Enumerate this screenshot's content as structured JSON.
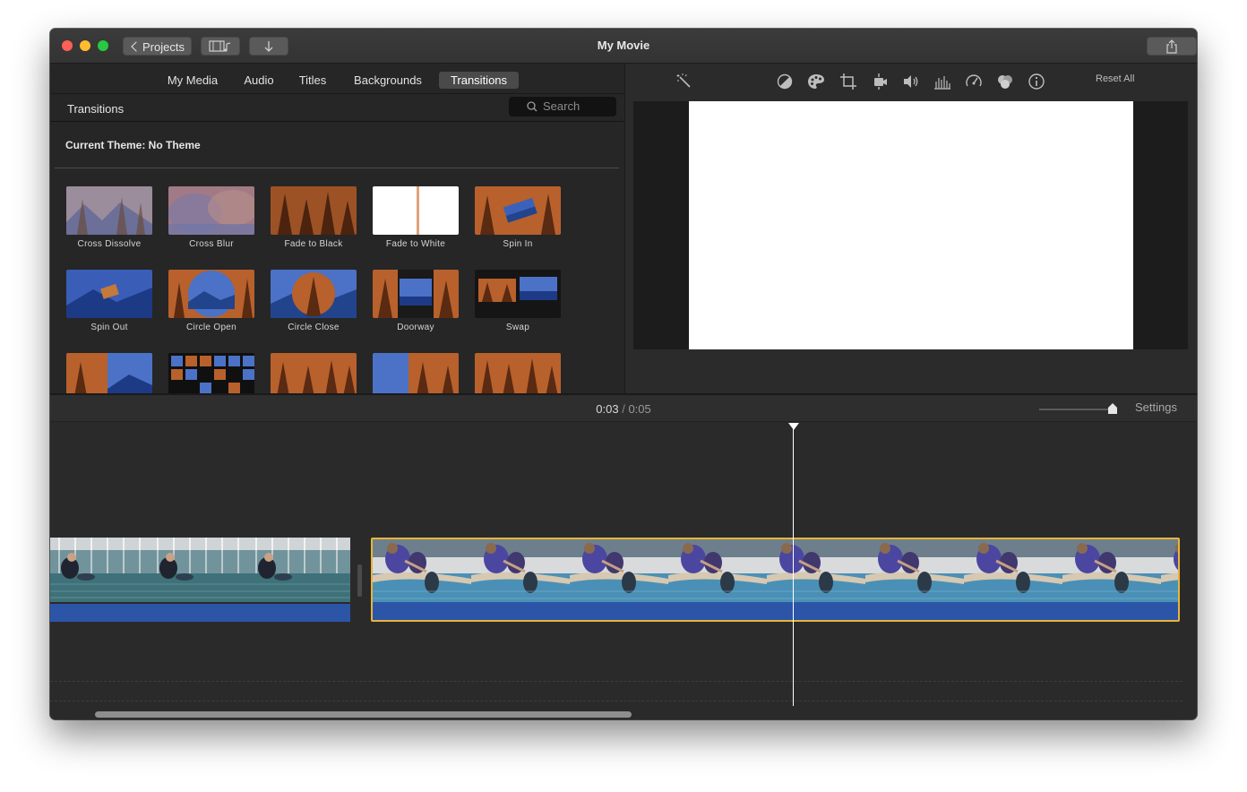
{
  "window": {
    "title": "My Movie"
  },
  "toolbar": {
    "projects_label": "Projects",
    "media_icon": "media-browser-icon",
    "import_icon": "import-arrow-icon",
    "share_icon": "share-icon"
  },
  "browser": {
    "tabs": [
      {
        "label": "My Media",
        "active": false
      },
      {
        "label": "Audio",
        "active": false
      },
      {
        "label": "Titles",
        "active": false
      },
      {
        "label": "Backgrounds",
        "active": false
      },
      {
        "label": "Transitions",
        "active": true
      }
    ],
    "section_title": "Transitions",
    "search_placeholder": "Search",
    "theme_label": "Current Theme: No Theme",
    "transitions": [
      {
        "label": "Cross Dissolve"
      },
      {
        "label": "Cross Blur"
      },
      {
        "label": "Fade to Black"
      },
      {
        "label": "Fade to White"
      },
      {
        "label": "Spin In"
      },
      {
        "label": "Spin Out"
      },
      {
        "label": "Circle Open"
      },
      {
        "label": "Circle Close"
      },
      {
        "label": "Doorway"
      },
      {
        "label": "Swap"
      }
    ]
  },
  "viewer": {
    "tools": [
      "magic-wand-icon",
      "color-balance-icon",
      "color-correction-icon",
      "crop-icon",
      "stabilization-icon",
      "volume-icon",
      "equalizer-icon",
      "speed-icon",
      "noise-reduction-icon",
      "info-icon"
    ],
    "reset_label": "Reset All"
  },
  "timeline": {
    "current_time": "0:03",
    "separator": "/",
    "duration": "0:05",
    "settings_label": "Settings",
    "clips": [
      {
        "name": "clip-1",
        "selected": false
      },
      {
        "name": "clip-2",
        "selected": true
      }
    ]
  },
  "colors": {
    "accent_selected": "#e8b43a",
    "audio_track": "#2c55a8",
    "window_bg": "#2b2b2b"
  }
}
